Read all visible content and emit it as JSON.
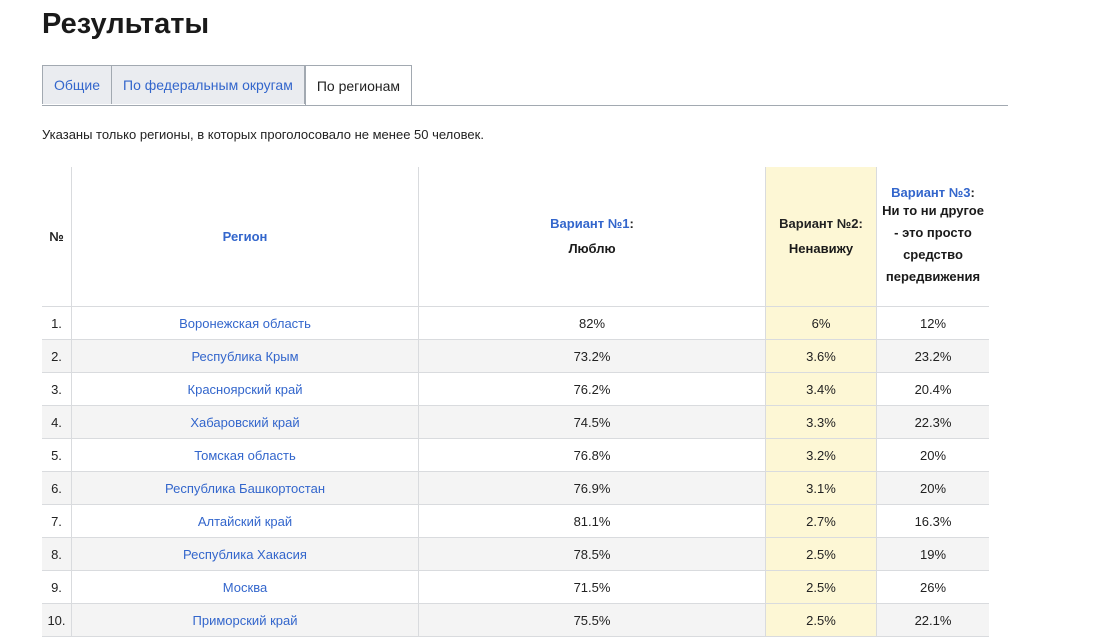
{
  "title": "Результаты",
  "tabs": [
    {
      "label": "Общие",
      "active": false
    },
    {
      "label": "По федеральным округам",
      "active": false
    },
    {
      "label": "По регионам",
      "active": true
    }
  ],
  "note": "Указаны только регионы, в которых проголосовало не менее 50 человек.",
  "table": {
    "headers": {
      "num": "№",
      "region": "Регион",
      "v1_title": "Вариант №1",
      "v1_sub": "Люблю",
      "v2_title": "Вариант №2",
      "v2_sub": "Ненавижу",
      "v3_title": "Вариант №3",
      "v3_sub": "Ни то ни другое - это просто средство передвижения"
    },
    "rows": [
      {
        "num": "1.",
        "region": "Воронежская область",
        "v1": "82%",
        "v2": "6%",
        "v3": "12%"
      },
      {
        "num": "2.",
        "region": "Республика Крым",
        "v1": "73.2%",
        "v2": "3.6%",
        "v3": "23.2%"
      },
      {
        "num": "3.",
        "region": "Красноярский край",
        "v1": "76.2%",
        "v2": "3.4%",
        "v3": "20.4%"
      },
      {
        "num": "4.",
        "region": "Хабаровский край",
        "v1": "74.5%",
        "v2": "3.3%",
        "v3": "22.3%"
      },
      {
        "num": "5.",
        "region": "Томская область",
        "v1": "76.8%",
        "v2": "3.2%",
        "v3": "20%"
      },
      {
        "num": "6.",
        "region": "Республика Башкортостан",
        "v1": "76.9%",
        "v2": "3.1%",
        "v3": "20%"
      },
      {
        "num": "7.",
        "region": "Алтайский край",
        "v1": "81.1%",
        "v2": "2.7%",
        "v3": "16.3%"
      },
      {
        "num": "8.",
        "region": "Республика Хакасия",
        "v1": "78.5%",
        "v2": "2.5%",
        "v3": "19%"
      },
      {
        "num": "9.",
        "region": "Москва",
        "v1": "71.5%",
        "v2": "2.5%",
        "v3": "26%"
      },
      {
        "num": "10.",
        "region": "Приморский край",
        "v1": "75.5%",
        "v2": "2.5%",
        "v3": "22.1%"
      }
    ]
  },
  "colors": {
    "link": "#3366cc",
    "highlight_column": "#fdf7d5",
    "tab_bg": "#eaecf0",
    "zebra": "#f4f4f4"
  }
}
